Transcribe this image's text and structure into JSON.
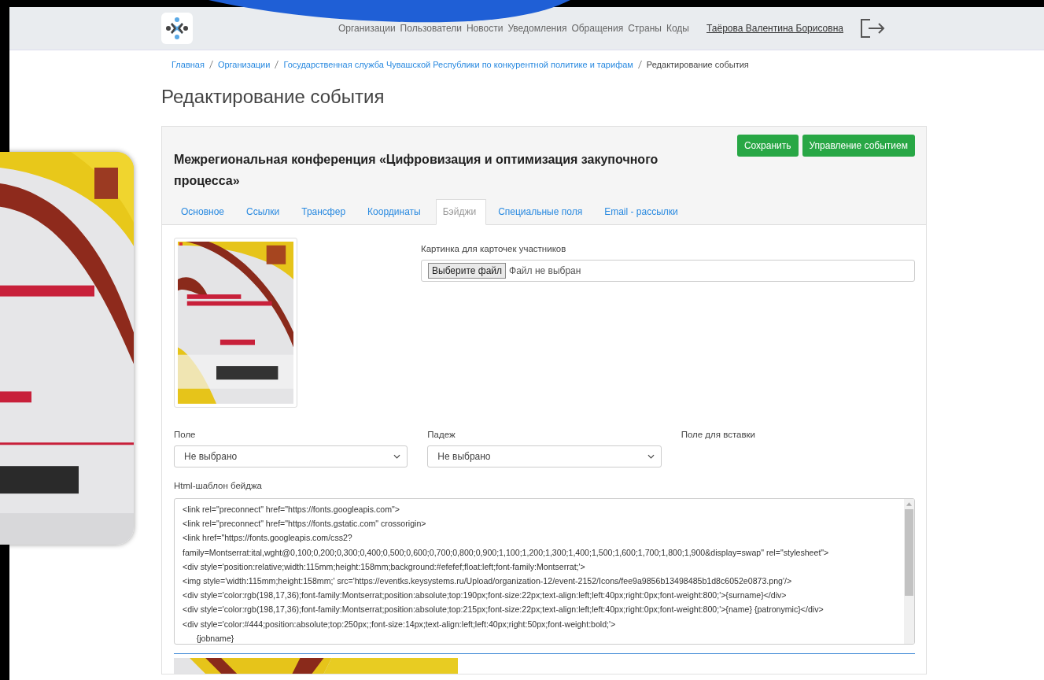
{
  "nav": {
    "items": [
      "Организации",
      "Пользователи",
      "Новости",
      "Уведомления",
      "Обращения",
      "Страны",
      "Коды"
    ],
    "user": "Таёрова Валентина Борисовна"
  },
  "breadcrumbs": {
    "links": [
      "Главная",
      "Организации",
      "Государственная служба Чувашской Республики по конкурентной политике и тарифам"
    ],
    "current": "Редактирование события"
  },
  "page_title": "Редактирование события",
  "event": {
    "title": "Межрегиональная конференция «Цифровизация и оптимизация закупочного процесса»",
    "buttons": [
      "Сохранить",
      "Управление событием"
    ]
  },
  "tabs": [
    {
      "label": "Основное",
      "selected": false
    },
    {
      "label": "Ссылки",
      "selected": false
    },
    {
      "label": "Трансфер",
      "selected": false
    },
    {
      "label": "Координаты",
      "selected": false
    },
    {
      "label": "Бэйджи",
      "selected": true
    },
    {
      "label": "Специальные поля",
      "selected": false
    },
    {
      "label": "Email - рассылки",
      "selected": false
    }
  ],
  "image_field": {
    "label": "Картинка для карточек участников",
    "button": "Выберите файл",
    "status": "Файл не выбран"
  },
  "selects": [
    {
      "label": "Поле",
      "value": "Не выбрано"
    },
    {
      "label": "Падеж",
      "value": "Не выбрано"
    }
  ],
  "insert_field": {
    "label": "Поле для вставки"
  },
  "template": {
    "label": "Html-шаблон бейджа",
    "lines": [
      "<link rel=\"preconnect\" href=\"https://fonts.googleapis.com\">",
      "<link rel=\"preconnect\" href=\"https://fonts.gstatic.com\" crossorigin>",
      "<link href=\"https://fonts.googleapis.com/css2?",
      "family=Montserrat:ital,wght@0,100;0,200;0,300;0,400;0,500;0,600;0,700;0,800;0,900;1,100;1,200;1,300;1,400;1,500;1,600;1,700;1,800;1,900&display=swap\" rel=\"stylesheet\">",
      "<div style='position:relative;width:115mm;height:158mm;background:#efefef;float:left;font-family:Montserrat;'>",
      "<img style='width:115mm;height:158mm;' src='https://eventks.keysystems.ru/Upload/organization-12/event-2152/Icons/fee9a9856b13498485b1d8c6052e0873.png'/>",
      "<div style='color:rgb(198,17,36);font-family:Montserrat;position:absolute;top:190px;font-size:22px;text-align:left;left:40px;right:0px;font-weight:800;'>{surname}</div>",
      "<div style='color:rgb(198,17,36);font-family:Montserrat;position:absolute;top:215px;font-size:22px;text-align:left;left:40px;right:0px;font-weight:800;'>{name} {patronymic}</div>",
      "<div style='color:#444;position:absolute;top:250px;;font-size:14px;text-align:left;left:40px;right:50px;font-weight:bold;'>",
      "      {jobname}"
    ]
  }
}
